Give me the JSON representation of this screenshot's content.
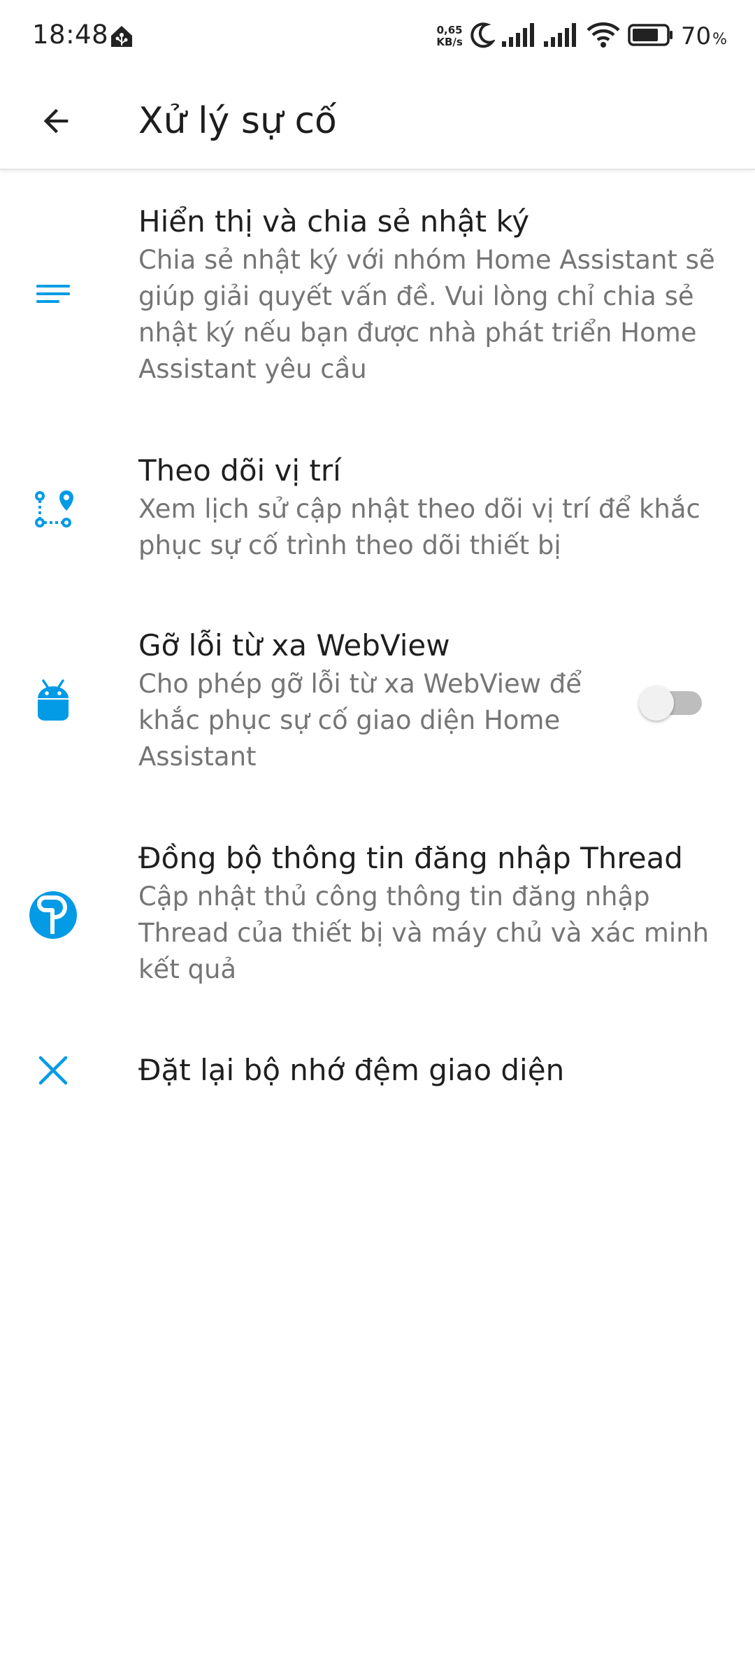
{
  "status_bar": {
    "time": "18:48",
    "net_speed_value": "0,65",
    "net_speed_unit": "KB/s",
    "battery_percent": "70",
    "battery_percent_sign": "%",
    "icons": [
      "home-assistant-icon",
      "moon-icon",
      "signal-icon",
      "signal-icon",
      "wifi-icon",
      "battery-icon"
    ]
  },
  "app_bar": {
    "title": "Xử lý sự cố",
    "back_icon": "arrow-back-icon"
  },
  "accent_color": "#039be5",
  "items": [
    {
      "icon": "notes-lines-icon",
      "title": "Hiển thị và chia sẻ nhật ký",
      "summary": "Chia sẻ nhật ký với nhóm Home Assistant sẽ giúp giải quyết vấn đề. Vui lòng chỉ chia sẻ nhật ký nếu bạn được nhà phát triển Home Assistant yêu cầu"
    },
    {
      "icon": "location-route-icon",
      "title": "Theo dõi vị trí",
      "summary": "Xem lịch sử cập nhật theo dõi vị trí để khắc phục sự cố trình theo dõi thiết bị"
    },
    {
      "icon": "android-icon",
      "title": "Gỡ lỗi từ xa WebView",
      "summary": "Cho phép gỡ lỗi từ xa WebView để khắc phục sự cố giao diện Home Assistant",
      "toggle_on": false
    },
    {
      "icon": "thread-icon",
      "title": "Đồng bộ thông tin đăng nhập Thread",
      "summary": "Cập nhật thủ công thông tin đăng nhập Thread của thiết bị và máy chủ và xác minh kết quả"
    },
    {
      "icon": "close-icon",
      "title": "Đặt lại bộ nhớ đệm giao diện"
    }
  ]
}
